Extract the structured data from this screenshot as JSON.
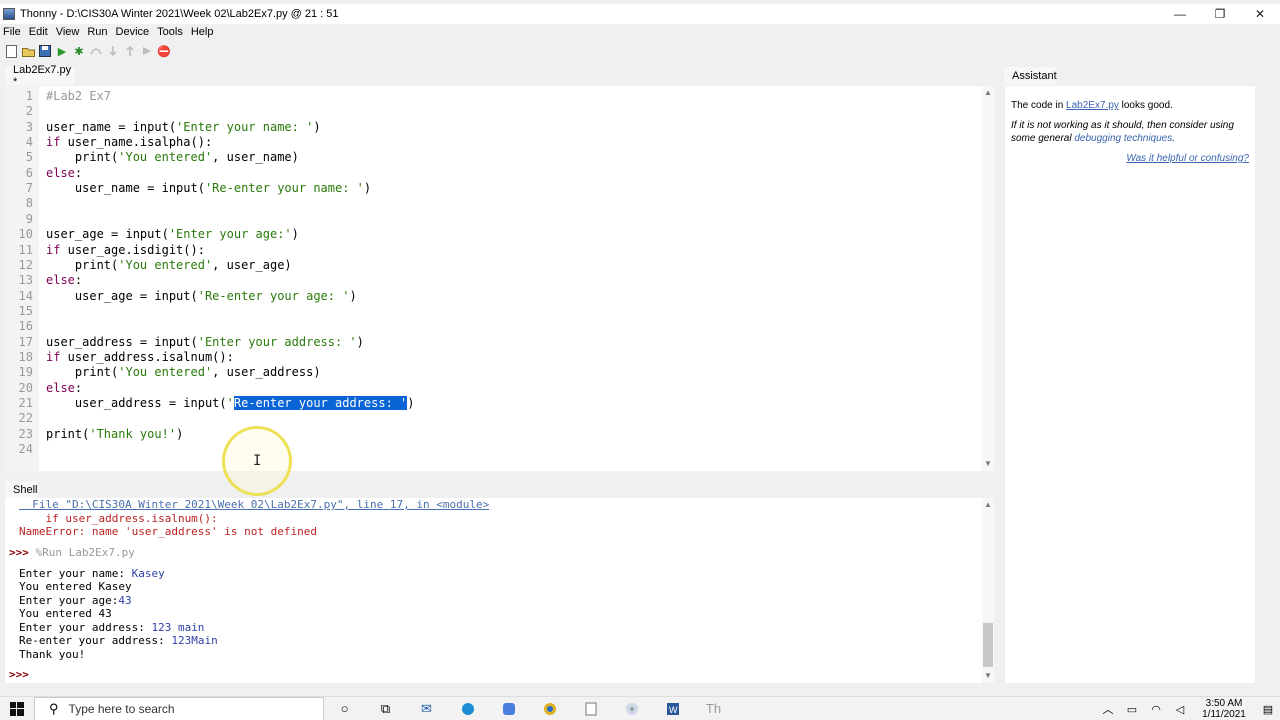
{
  "window": {
    "title": "Thonny  -  D:\\CIS30A Winter 2021\\Week 02\\Lab2Ex7.py  @  21 : 51",
    "minimize_glyph": "—",
    "maximize_glyph": "❐",
    "close_glyph": "✕"
  },
  "menu": [
    "File",
    "Edit",
    "View",
    "Run",
    "Device",
    "Tools",
    "Help"
  ],
  "toolbar": {
    "icons": [
      "new-file-icon",
      "open-file-icon",
      "save-icon",
      "run-icon",
      "debug-icon",
      "step-over-icon",
      "step-into-icon",
      "step-out-icon",
      "resume-icon",
      "stop-icon"
    ],
    "run_glyph": "▶",
    "debug_glyph": "✱",
    "stop_glyph": "⛔"
  },
  "editor": {
    "tab_label": "Lab2Ex7.py *",
    "lines": [
      {
        "n": "1",
        "parts": [
          {
            "t": "#Lab2 Ex7",
            "c": "com"
          }
        ]
      },
      {
        "n": "2",
        "parts": []
      },
      {
        "n": "3",
        "parts": [
          {
            "t": "user_name = input(",
            "c": ""
          },
          {
            "t": "'Enter your name: '",
            "c": "str"
          },
          {
            "t": ")",
            "c": ""
          }
        ]
      },
      {
        "n": "4",
        "parts": [
          {
            "t": "if",
            "c": "kw"
          },
          {
            "t": " user_name.isalpha():",
            "c": ""
          }
        ]
      },
      {
        "n": "5",
        "parts": [
          {
            "t": "    print(",
            "c": ""
          },
          {
            "t": "'You entered'",
            "c": "str"
          },
          {
            "t": ", user_name)",
            "c": ""
          }
        ]
      },
      {
        "n": "6",
        "parts": [
          {
            "t": "else",
            "c": "kw"
          },
          {
            "t": ":",
            "c": ""
          }
        ]
      },
      {
        "n": "7",
        "parts": [
          {
            "t": "    user_name = input(",
            "c": ""
          },
          {
            "t": "'Re-enter your name: '",
            "c": "str"
          },
          {
            "t": ")",
            "c": ""
          }
        ]
      },
      {
        "n": "8",
        "parts": []
      },
      {
        "n": "9",
        "parts": []
      },
      {
        "n": "10",
        "parts": [
          {
            "t": "user_age = input(",
            "c": ""
          },
          {
            "t": "'Enter your age:'",
            "c": "str"
          },
          {
            "t": ")",
            "c": ""
          }
        ]
      },
      {
        "n": "11",
        "parts": [
          {
            "t": "if",
            "c": "kw"
          },
          {
            "t": " user_age.isdigit():",
            "c": ""
          }
        ]
      },
      {
        "n": "12",
        "parts": [
          {
            "t": "    print(",
            "c": ""
          },
          {
            "t": "'You entered'",
            "c": "str"
          },
          {
            "t": ", user_age)",
            "c": ""
          }
        ]
      },
      {
        "n": "13",
        "parts": [
          {
            "t": "else",
            "c": "kw"
          },
          {
            "t": ":",
            "c": ""
          }
        ]
      },
      {
        "n": "14",
        "parts": [
          {
            "t": "    user_age = input(",
            "c": ""
          },
          {
            "t": "'Re-enter your age: '",
            "c": "str"
          },
          {
            "t": ")",
            "c": ""
          }
        ]
      },
      {
        "n": "15",
        "parts": []
      },
      {
        "n": "16",
        "parts": []
      },
      {
        "n": "17",
        "parts": [
          {
            "t": "user_address = input(",
            "c": ""
          },
          {
            "t": "'Enter your address: '",
            "c": "str"
          },
          {
            "t": ")",
            "c": ""
          }
        ]
      },
      {
        "n": "18",
        "parts": [
          {
            "t": "if",
            "c": "kw"
          },
          {
            "t": " user_address.isalnum():",
            "c": ""
          }
        ]
      },
      {
        "n": "19",
        "parts": [
          {
            "t": "    print(",
            "c": ""
          },
          {
            "t": "'You entered'",
            "c": "str"
          },
          {
            "t": ", user_address)",
            "c": ""
          }
        ]
      },
      {
        "n": "20",
        "parts": [
          {
            "t": "else",
            "c": "kw"
          },
          {
            "t": ":",
            "c": ""
          }
        ]
      },
      {
        "n": "21",
        "parts": [
          {
            "t": "    user_address = input(",
            "c": ""
          },
          {
            "t": "'",
            "c": "str"
          },
          {
            "t": "Re-enter your address: '",
            "c": "sel"
          },
          {
            "t": ")",
            "c": ""
          }
        ]
      },
      {
        "n": "22",
        "parts": []
      },
      {
        "n": "23",
        "parts": [
          {
            "t": "print(",
            "c": ""
          },
          {
            "t": "'Thank you!'",
            "c": "str"
          },
          {
            "t": ")",
            "c": ""
          }
        ]
      },
      {
        "n": "24",
        "parts": []
      }
    ]
  },
  "shell": {
    "tab_label": "Shell",
    "lines": [
      {
        "parts": [
          {
            "t": "  File \"D:\\CIS30A Winter 2021\\Week 02\\Lab2Ex7.py\", line 17, in <module>",
            "c": "s-link"
          }
        ]
      },
      {
        "parts": [
          {
            "t": "    if user_address.isalnum():",
            "c": "s-err"
          }
        ]
      },
      {
        "parts": [
          {
            "t": "NameError: name 'user_address' is not defined",
            "c": "s-err"
          }
        ]
      },
      {
        "parts": [
          {
            "t": ">>> ",
            "c": "s-prompt"
          },
          {
            "t": "%Run Lab2Ex7.py",
            "c": "s-cmd"
          }
        ]
      },
      {
        "parts": []
      },
      {
        "parts": [
          {
            "t": "Enter your name: ",
            "c": ""
          },
          {
            "t": "Kasey",
            "c": "s-in"
          }
        ]
      },
      {
        "parts": [
          {
            "t": "You entered Kasey",
            "c": ""
          }
        ]
      },
      {
        "parts": [
          {
            "t": "Enter your age:",
            "c": ""
          },
          {
            "t": "43",
            "c": "s-in"
          }
        ]
      },
      {
        "parts": [
          {
            "t": "You entered 43",
            "c": ""
          }
        ]
      },
      {
        "parts": [
          {
            "t": "Enter your address: ",
            "c": ""
          },
          {
            "t": "123 main",
            "c": "s-in"
          }
        ]
      },
      {
        "parts": [
          {
            "t": "Re-enter your address: ",
            "c": ""
          },
          {
            "t": "123Main",
            "c": "s-in"
          }
        ]
      },
      {
        "parts": [
          {
            "t": "Thank you!",
            "c": ""
          }
        ]
      },
      {
        "parts": []
      },
      {
        "parts": [
          {
            "t": ">>> ",
            "c": "s-prompt"
          }
        ]
      }
    ]
  },
  "assistant": {
    "tab_label": "Assistant",
    "msg_prefix": "The code in ",
    "msg_file": "Lab2Ex7.py",
    "msg_suffix": " looks good.",
    "advice_prefix": "If it is not working as it should, then consider using some general ",
    "advice_link": "debugging techniques",
    "advice_suffix": ".",
    "feedback_link": "Was it helpful or confusing?"
  },
  "taskbar": {
    "search_placeholder": "Type here to search",
    "apps": [
      "cortana-icon",
      "task-view-icon",
      "mail-icon",
      "edge-icon",
      "app-icon",
      "chrome-icon",
      "file-icon",
      "media-icon",
      "word-icon",
      "thonny-taskbar-icon"
    ],
    "time": "3:50 AM",
    "date": "1/11/2021"
  }
}
